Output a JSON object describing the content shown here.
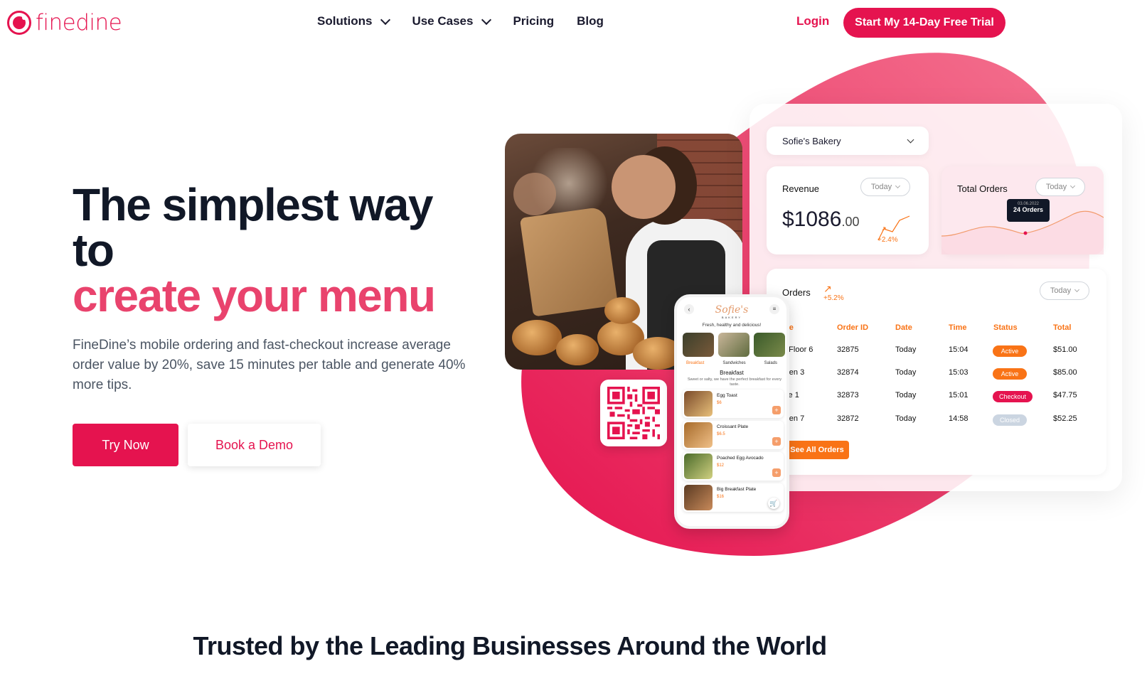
{
  "brand": {
    "name": "finedine"
  },
  "nav": {
    "items": [
      {
        "label": "Solutions",
        "dropdown": true
      },
      {
        "label": "Use Cases",
        "dropdown": true
      },
      {
        "label": "Pricing",
        "dropdown": false
      },
      {
        "label": "Blog",
        "dropdown": false
      }
    ],
    "login": "Login",
    "cta": "Start My 14-Day Free Trial"
  },
  "hero": {
    "headline_line1": "The simplest way to",
    "headline_line2": "create your menu",
    "subtext": "FineDine’s mobile ordering and fast-checkout increase average order value by 20%, save 15 minutes per table and generate 40% more tips.",
    "primary_button": "Try Now",
    "secondary_button": "Book a Demo"
  },
  "dashboard": {
    "restaurant_select": "Sofie's Bakery",
    "revenue": {
      "title": "Revenue",
      "filter": "Today",
      "value_main": "$1086",
      "value_cents": ".00",
      "change": "+2.4%"
    },
    "total_orders": {
      "title": "Total Orders",
      "filter": "Today",
      "tooltip_date": "03.06.2022",
      "tooltip_value": "24 Orders"
    },
    "orders": {
      "title": "Orders",
      "change": "+5.2%",
      "filter": "Today",
      "columns": [
        "ble",
        "Order ID",
        "Date",
        "Time",
        "Status",
        "Total"
      ],
      "rows": [
        {
          "table": "d Floor 6",
          "id": "32875",
          "date": "Today",
          "time": "15:04",
          "status": "Active",
          "total": "$51.00"
        },
        {
          "table": "rden 3",
          "id": "32874",
          "date": "Today",
          "time": "15:03",
          "status": "Active",
          "total": "$85.00"
        },
        {
          "table": "ide 1",
          "id": "32873",
          "date": "Today",
          "time": "15:01",
          "status": "Checkout",
          "total": "$47.75"
        },
        {
          "table": "rden 7",
          "id": "32872",
          "date": "Today",
          "time": "14:58",
          "status": "Closed",
          "total": "$52.25"
        }
      ],
      "see_all": "See All Orders"
    },
    "colors": {
      "active": "#f97316",
      "checkout": "#e5134f",
      "closed": "#cbd5e1"
    }
  },
  "phone": {
    "brand": "Sofie's",
    "brand_sub": "BAKERY",
    "tagline": "Fresh, healthy and delicious!",
    "tabs": [
      "Breakfast",
      "Sandwiches",
      "Salads"
    ],
    "section": "Breakfast",
    "section_desc": "Sweet or salty, we have the perfect breakfast for every taste.",
    "items": [
      {
        "name": "Egg Toast",
        "price": "$6"
      },
      {
        "name": "Croissant Plate",
        "price": "$6.5"
      },
      {
        "name": "Poached Egg Avocado",
        "price": "$12"
      },
      {
        "name": "Big Breakfast Plate",
        "price": "$16"
      }
    ]
  },
  "trusted_heading": "Trusted by the Leading Businesses Around the World",
  "colors": {
    "brand": "#e5134f",
    "accent_text": "#e9436d",
    "orange": "#f97316"
  }
}
